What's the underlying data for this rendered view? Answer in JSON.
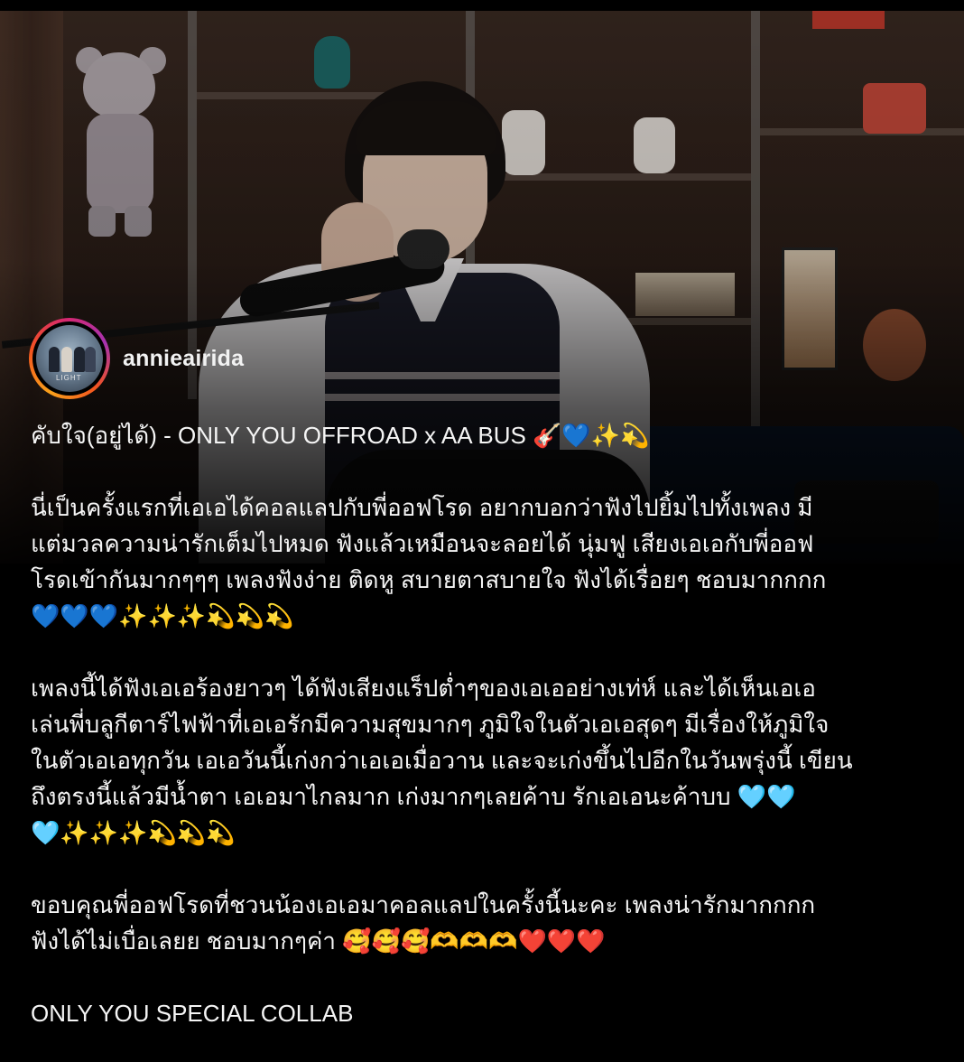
{
  "post": {
    "author": {
      "username": "annieairida",
      "avatar_icon": "group-photo-avatar",
      "avatar_caption": "LIGHT"
    },
    "caption": {
      "title_line": "คับใจ(อยู่ได้) - ONLY YOU OFFROAD x AA BUS 🎸💙✨💫",
      "paragraph_1": "นี่เป็นครั้งแรกที่เอเอได้คอลแลปกับพี่ออฟโรด อยากบอกว่าฟังไปยิ้มไปทั้งเพลง มี\nแต่มวลความน่ารักเต็มไปหมด ฟังแล้วเหมือนจะลอยได้ นุ่มฟู เสียงเอเอกับพี่ออฟ\nโรดเข้ากันมากๆๆๆ เพลงฟังง่าย ติดหู สบายตาสบายใจ ฟังได้เรื่อยๆ ชอบมากกกก\n💙💙💙✨✨✨💫💫💫",
      "paragraph_2": "เพลงนี้ได้ฟังเอเอร้องยาวๆ ได้ฟังเสียงแร็ปต่ำๆของเอเออย่างเท่ห์ และได้เห็นเอเอ\nเล่นพี่บลูกีตาร์ไฟฟ้าที่เอเอรักมีความสุขมากๆ ภูมิใจในตัวเอเอสุดๆ มีเรื่องให้ภูมิใจ\nในตัวเอเอทุกวัน เอเอวันนี้เก่งกว่าเอเอเมื่อวาน และจะเก่งขึ้นไปอีกในวันพรุ่งนี้ เขียน\nถึงตรงนี้แล้วมีน้ำตา เอเอมาไกลมาก เก่งมากๆเลยค้าบ รักเอเอนะค้าบบ 🩵🩵\n🩵✨✨✨💫💫💫",
      "paragraph_3": "ขอบคุณพี่ออฟโรดที่ชวนน้องเอเอมาคอลแลปในครั้งนี้นะคะ เพลงน่ารักมากกกก\nฟังได้ไม่เบื่อเลยย ชอบมากๆค่า 🥰🥰🥰🫶🫶🫶❤️❤️❤️",
      "closing_line": "ONLY YOU SPECIAL COLLAB"
    }
  },
  "media": {
    "description_icon": "video-frame-singer-with-microphone"
  },
  "colors": {
    "background": "#000000",
    "text": "#f5f5f5",
    "story_ring_start": "#f9a11b",
    "story_ring_end": "#a632b0"
  }
}
